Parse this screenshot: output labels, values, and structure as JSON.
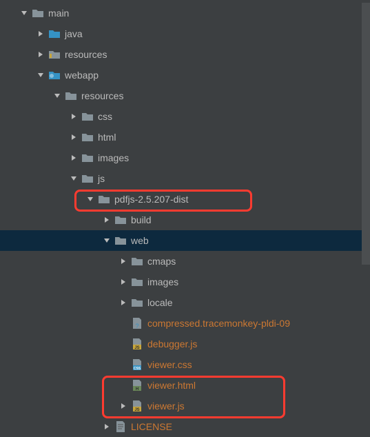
{
  "tree": {
    "main": "main",
    "java": "java",
    "resources_top": "resources",
    "webapp": "webapp",
    "resources": "resources",
    "css": "css",
    "html": "html",
    "images": "images",
    "js": "js",
    "pdfjs": "pdfjs-2.5.207-dist",
    "build": "build",
    "web": "web",
    "cmaps": "cmaps",
    "images2": "images",
    "locale": "locale",
    "compressed": "compressed.tracemonkey-pldi-09",
    "debugger": "debugger.js",
    "viewer_css": "viewer.css",
    "viewer_html": "viewer.html",
    "viewer_js": "viewer.js",
    "license": "LICENSE"
  }
}
